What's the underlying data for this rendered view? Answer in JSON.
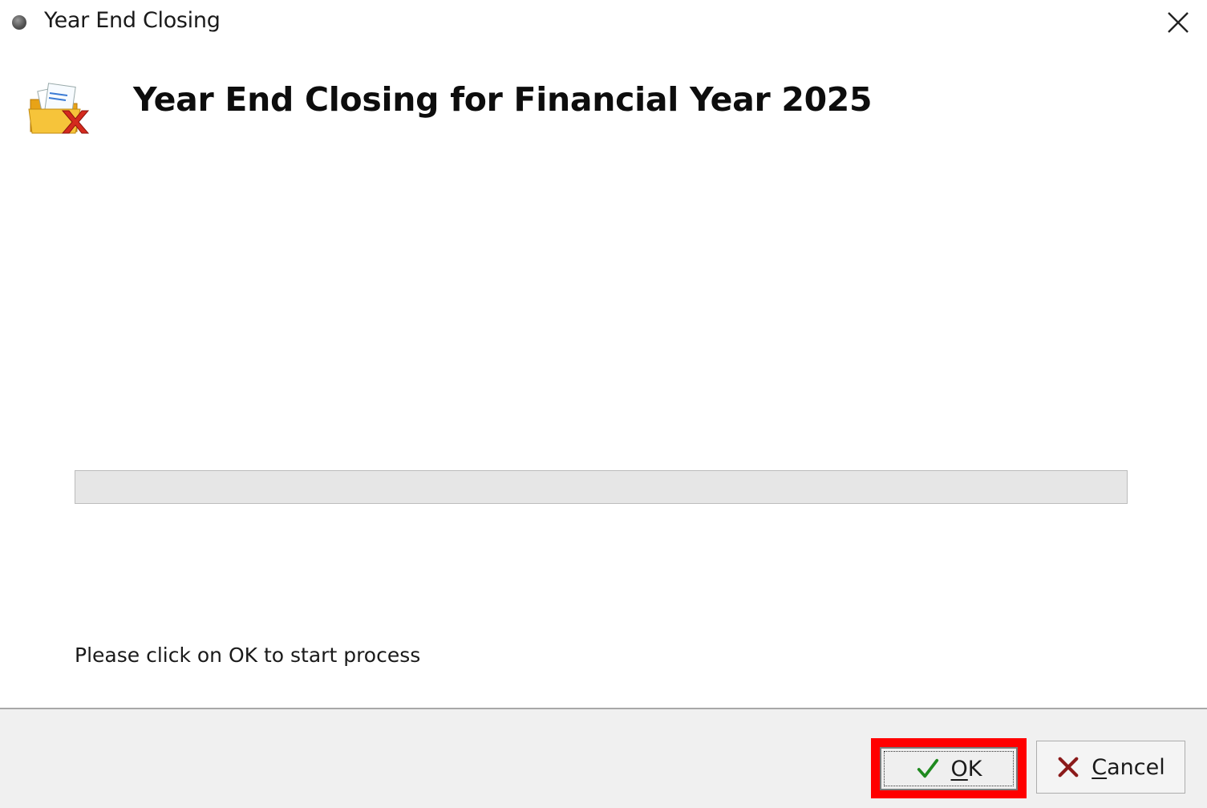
{
  "window": {
    "title": "Year End Closing"
  },
  "header": {
    "title": "Year End Closing for Financial Year 2025",
    "icon": "folder-close-icon"
  },
  "progress": {
    "value_percent": 0
  },
  "status": {
    "message": "Please click on OK to start process"
  },
  "buttons": {
    "ok": {
      "mnemonic": "O",
      "rest": "K",
      "icon": "checkmark-icon"
    },
    "cancel": {
      "mnemonic": "C",
      "rest": "ancel",
      "icon": "x-icon"
    }
  },
  "colors": {
    "highlight": "#ff0000",
    "check": "#1f8a1f",
    "cancel_x": "#8b1a1a"
  }
}
